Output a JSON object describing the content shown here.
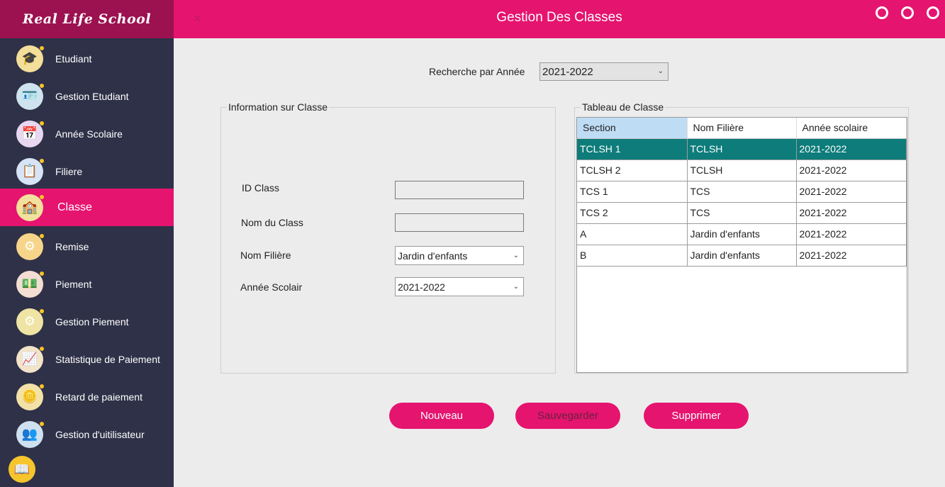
{
  "brand": "Real Life School",
  "header": {
    "title": "Gestion Des Classes",
    "close": "×"
  },
  "sidebar": {
    "items": [
      {
        "label": "Etudiant",
        "icon": "student-icon",
        "glyph": "🎓",
        "bg": "#f3df9a"
      },
      {
        "label": "Gestion Etudiant",
        "icon": "id-card-icon",
        "glyph": "🪪",
        "bg": "#cfe3ef"
      },
      {
        "label": "Année Scolaire",
        "icon": "calendar-icon",
        "glyph": "📅",
        "bg": "#e7d7f0"
      },
      {
        "label": "Filiere",
        "icon": "clipboard-icon",
        "glyph": "📋",
        "bg": "#d7e4f5"
      },
      {
        "label": "Classe",
        "icon": "classroom-icon",
        "glyph": "🏫",
        "bg": "#f1e19c",
        "active": true
      },
      {
        "label": "Remise",
        "icon": "discount-icon",
        "glyph": "⚙",
        "bg": "#f6d58a"
      },
      {
        "label": "Piement",
        "icon": "money-icon",
        "glyph": "💵",
        "bg": "#f4ddd3"
      },
      {
        "label": "Gestion Piement",
        "icon": "gear-checklist-icon",
        "glyph": "⚙",
        "bg": "#efe4a3"
      },
      {
        "label": "Statistique de Paiement",
        "icon": "chart-board-icon",
        "glyph": "📈",
        "bg": "#f2e3c9"
      },
      {
        "label": "Retard de paiement",
        "icon": "coin-hand-icon",
        "glyph": "🪙",
        "bg": "#f3e1a8"
      },
      {
        "label": "Gestion d'uitilisateur",
        "icon": "users-icon",
        "glyph": "👥",
        "bg": "#cfe0ef"
      }
    ],
    "bottom_icon": {
      "icon": "book-icon",
      "glyph": "📖"
    }
  },
  "search": {
    "label": "Recherche par Année",
    "value": "2021-2022"
  },
  "info": {
    "legend": "Information sur Classe",
    "id_label": "ID Class",
    "nom_label": "Nom du Class",
    "filiere_label": "Nom Filière",
    "filiere_value": "Jardin d'enfants",
    "annee_label": "Année Scolair",
    "annee_value": "2021-2022"
  },
  "table": {
    "legend": "Tableau de Classe",
    "headers": [
      "Section",
      "Nom Filière",
      "Année scolaire"
    ],
    "rows": [
      [
        "TCLSH 1",
        "TCLSH",
        "2021-2022"
      ],
      [
        "TCLSH 2",
        "TCLSH",
        "2021-2022"
      ],
      [
        "TCS 1",
        "TCS",
        "2021-2022"
      ],
      [
        "TCS 2",
        "TCS",
        "2021-2022"
      ],
      [
        "A",
        "Jardin d'enfants",
        "2021-2022"
      ],
      [
        "B",
        "Jardin d'enfants",
        "2021-2022"
      ]
    ]
  },
  "buttons": {
    "new": "Nouveau",
    "save": "Sauvegarder",
    "delete": "Supprimer"
  },
  "colors": {
    "accent": "#e5146f",
    "sidebar": "#2f3148",
    "brand_bg": "#9c1150",
    "row_selected": "#0d7c7a"
  }
}
